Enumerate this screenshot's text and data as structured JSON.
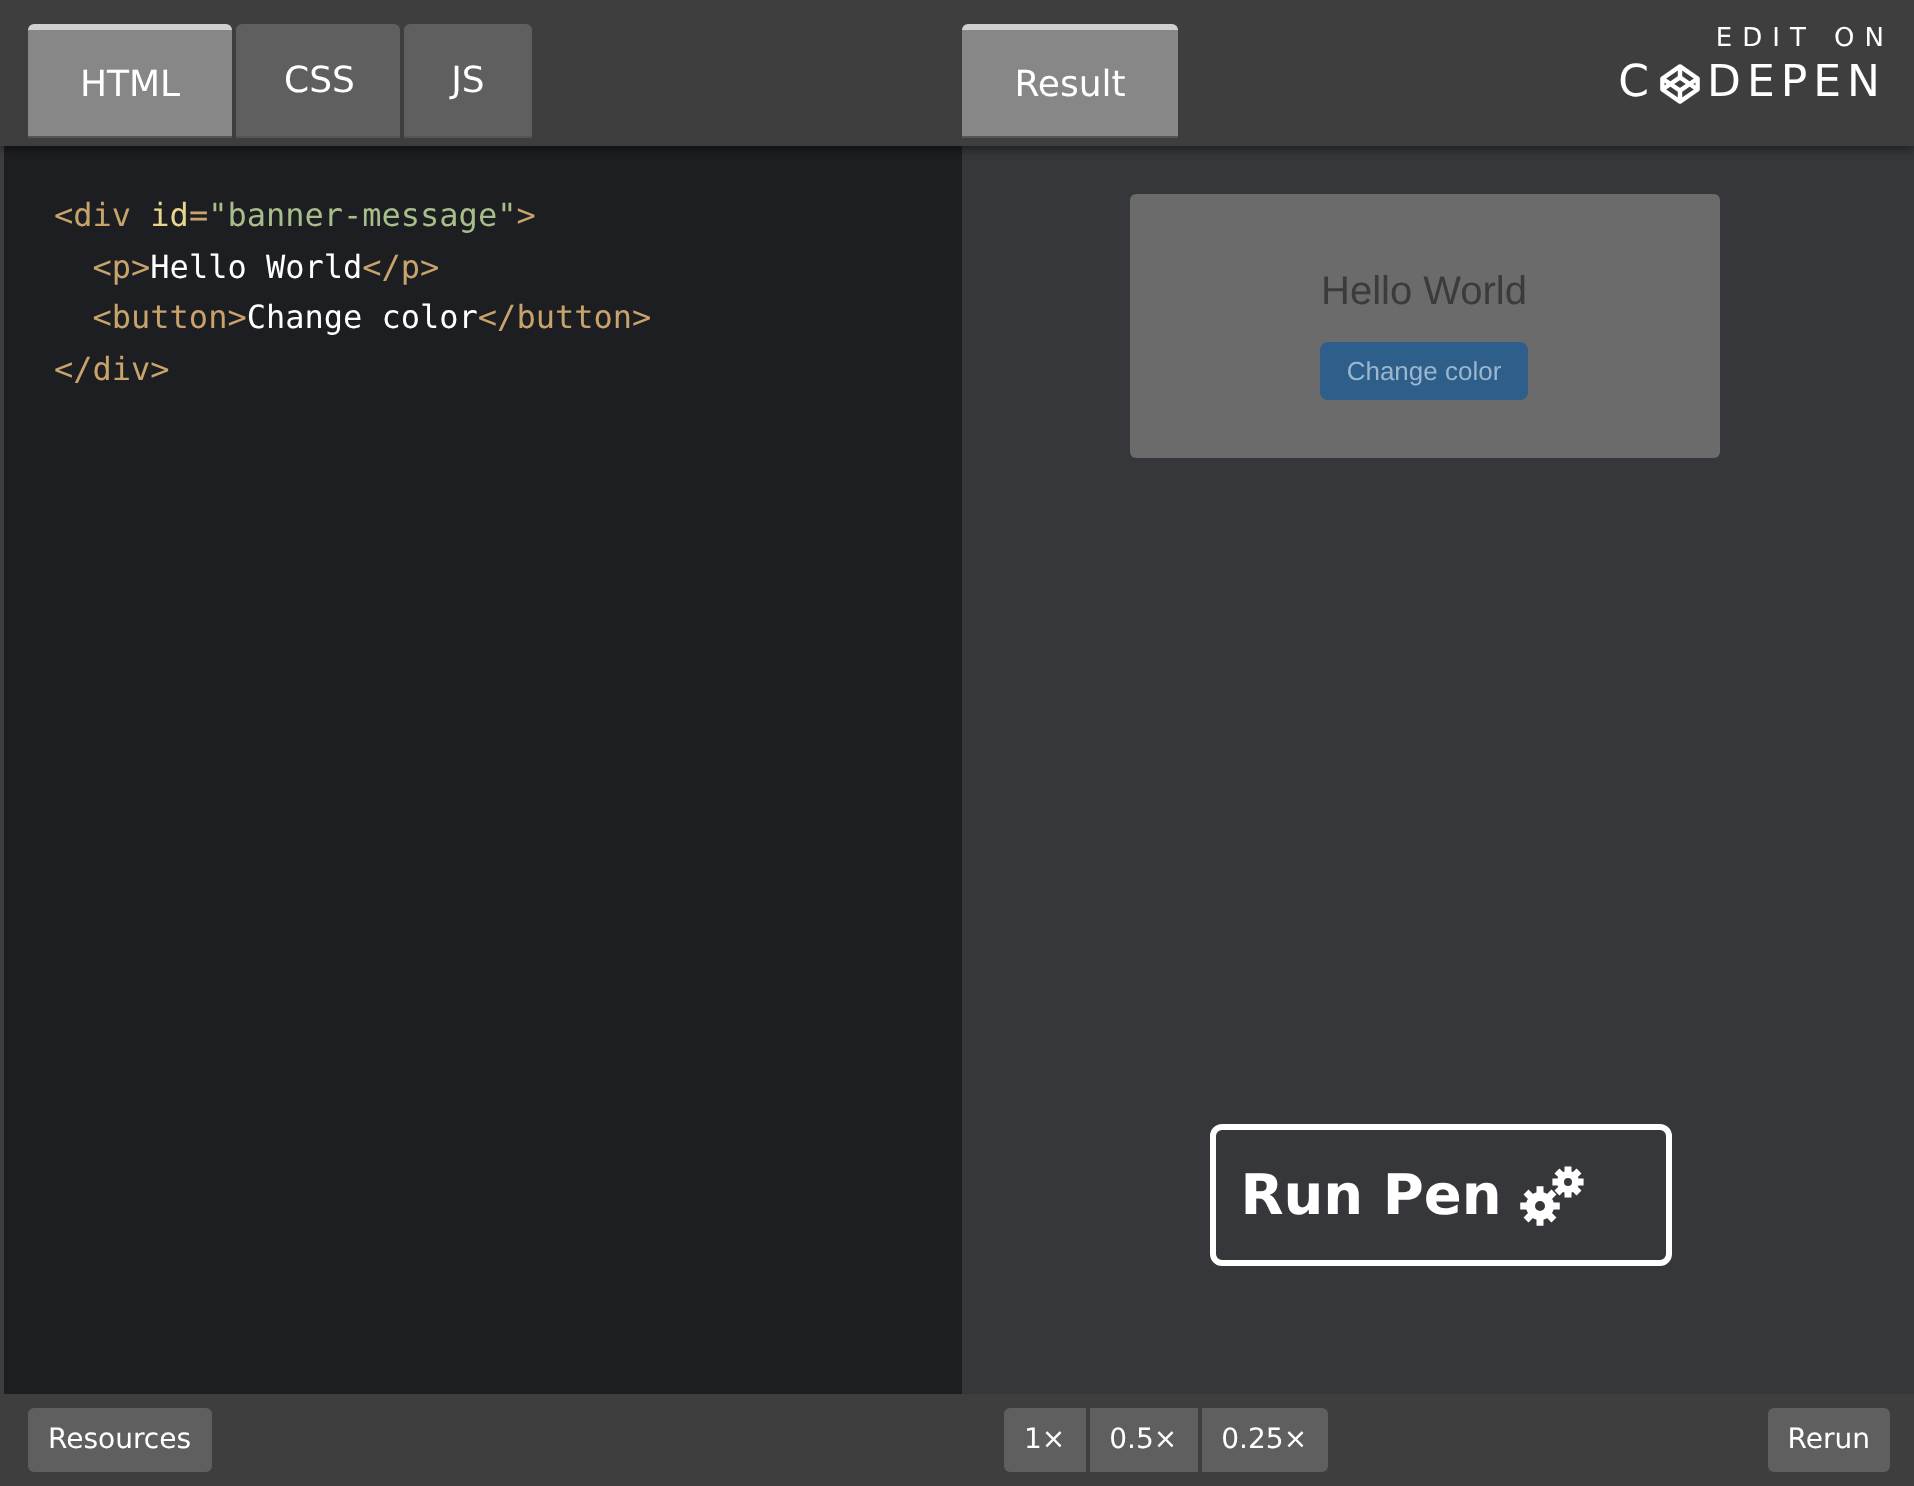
{
  "editor_tabs": [
    {
      "label": "HTML",
      "selected": true
    },
    {
      "label": "CSS",
      "selected": false
    },
    {
      "label": "JS",
      "selected": false
    }
  ],
  "result_tab": {
    "label": "Result",
    "selected": true
  },
  "brand": {
    "caption": "EDIT ON",
    "name_start": "C",
    "name_end": "DEPEN"
  },
  "code_lines": [
    {
      "tokens": [
        {
          "kind": "tag",
          "text": "<div "
        },
        {
          "kind": "attr",
          "text": "id"
        },
        {
          "kind": "tag",
          "text": "="
        },
        {
          "kind": "string",
          "text": "\"banner-message\""
        },
        {
          "kind": "tag",
          "text": ">"
        }
      ]
    },
    {
      "tokens": [
        {
          "kind": "tag",
          "text": "  <p>"
        },
        {
          "kind": "text",
          "text": "Hello World"
        },
        {
          "kind": "tag",
          "text": "</p>"
        }
      ]
    },
    {
      "tokens": [
        {
          "kind": "tag",
          "text": "  <button>"
        },
        {
          "kind": "text",
          "text": "Change color"
        },
        {
          "kind": "tag",
          "text": "</button>"
        }
      ]
    },
    {
      "tokens": [
        {
          "kind": "tag",
          "text": "</div>"
        }
      ]
    }
  ],
  "preview": {
    "message": "Hello World",
    "button": "Change color"
  },
  "run_button": {
    "label": "Run Pen"
  },
  "footer": {
    "resources": "Resources",
    "zoom_options": [
      {
        "label": "1×"
      },
      {
        "label": "0.5×"
      },
      {
        "label": "0.25×"
      }
    ],
    "rerun": "Rerun"
  }
}
